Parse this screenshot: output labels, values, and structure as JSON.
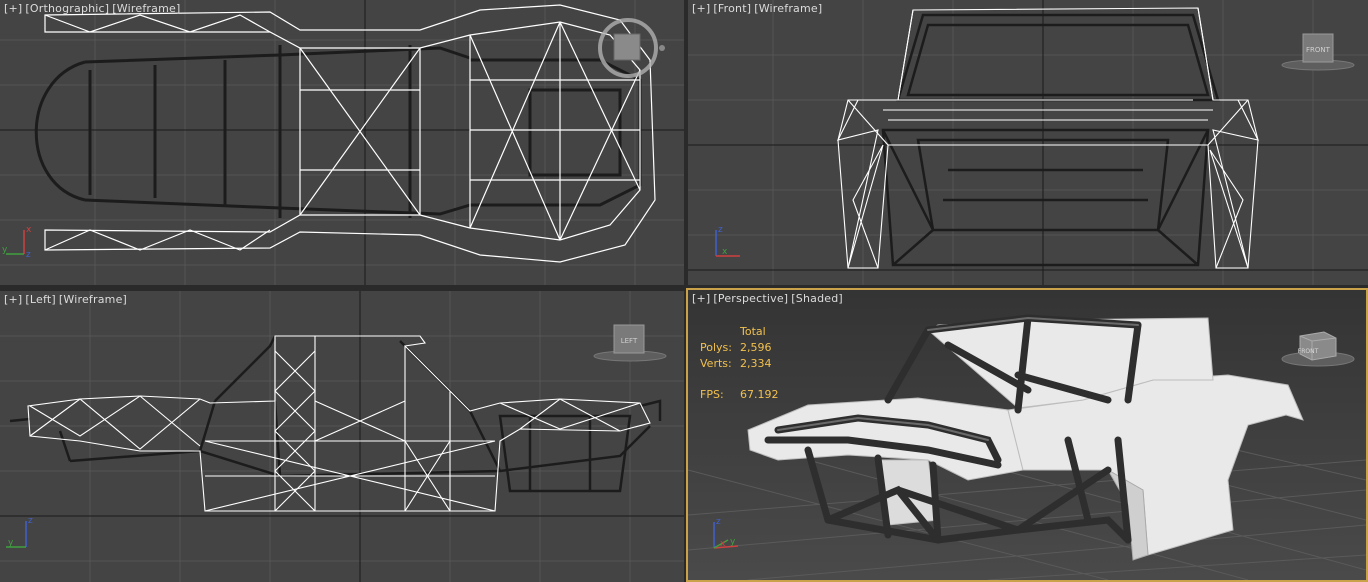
{
  "viewports": {
    "top_left": {
      "plus": "[+]",
      "view": "[Orthographic]",
      "mode": "[Wireframe]"
    },
    "top_right": {
      "plus": "[+]",
      "view": "[Front]",
      "mode": "[Wireframe]",
      "navcube_label": "FRONT"
    },
    "bottom_left": {
      "plus": "[+]",
      "view": "[Left]",
      "mode": "[Wireframe]",
      "navcube_label": "LEFT"
    },
    "bottom_right": {
      "plus": "[+]",
      "view": "[Perspective]",
      "mode": "[Shaded]",
      "navcube_label": "FRONT",
      "stats": {
        "header": "Total",
        "polys_label": "Polys:",
        "polys_value": "2,596",
        "verts_label": "Verts:",
        "verts_value": "2,334",
        "fps_label": "FPS:",
        "fps_value": "67.192"
      }
    }
  },
  "axis_labels": {
    "x": "x",
    "y": "y",
    "z": "z"
  },
  "colors": {
    "viewport_bg": "#444444",
    "active_border": "#c9a24a",
    "stats_text": "#f2c14e",
    "wire": "#ffffff",
    "frame": "#1c1c1c"
  }
}
